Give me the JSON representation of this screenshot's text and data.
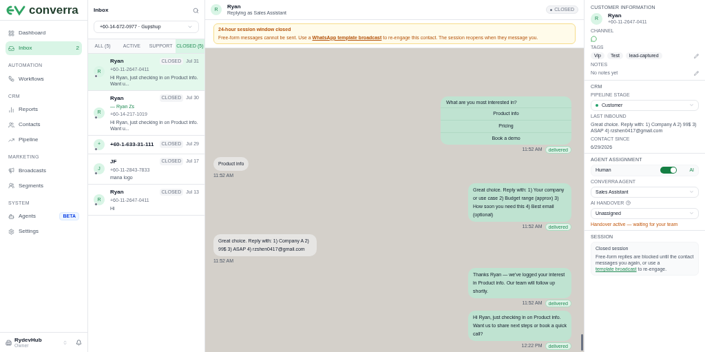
{
  "sidebar": {
    "logo": "converra",
    "sections": [
      {
        "items": [
          {
            "label": "Dashboard",
            "selected": false
          },
          {
            "label": "Inbox",
            "selected": true,
            "count": "2"
          }
        ]
      },
      {
        "heading": "AUTOMATION",
        "items": [
          {
            "label": "Workflows",
            "selected": false
          }
        ]
      },
      {
        "heading": "CRM",
        "items": [
          {
            "label": "Reports",
            "selected": false
          },
          {
            "label": "Contacts",
            "selected": false
          },
          {
            "label": "Pipeline",
            "selected": false
          }
        ]
      },
      {
        "heading": "MARKETING",
        "items": [
          {
            "label": "Broadcasts",
            "selected": false
          },
          {
            "label": "Segments",
            "selected": false
          }
        ]
      },
      {
        "heading": "SYSTEM",
        "items": [
          {
            "label": "Agents",
            "selected": false,
            "badge": "BETA"
          },
          {
            "label": "Settings",
            "selected": false
          }
        ]
      }
    ],
    "account": {
      "name": "RydevHub",
      "role": "Owner"
    }
  },
  "inbox": {
    "title": "Inbox",
    "channel": "+60-14-672-0977 · Gupshup",
    "tabs": [
      {
        "label": "ALL",
        "count": "(5)",
        "selected": false
      },
      {
        "label": "ACTIVE",
        "selected": false
      },
      {
        "label": "SUPPORT",
        "selected": false
      },
      {
        "label": "CLOSED",
        "count": "(5)",
        "selected": true
      }
    ],
    "conversations": [
      {
        "initial": "R",
        "name": "Ryan",
        "phone": "+60-11-2647-0411",
        "preview": "Hi Ryan, just checking in on Product info. Want u...",
        "status": "CLOSED",
        "date": "Jul 31",
        "selected": true
      },
      {
        "initial": "R",
        "name": "Ryan",
        "alias": "— Ryan Zs",
        "phone": "+60-14-217-1019",
        "preview": "Hi Ryan, just checking in on Product info. Want u...",
        "status": "CLOSED",
        "date": "Jul 30",
        "selected": false
      },
      {
        "initial": "+",
        "name": "+60-1-633-31-111",
        "status": "CLOSED",
        "date": "Jul 29",
        "selected": false
      },
      {
        "initial": "J",
        "name": "JF",
        "phone": "+60-11-2843-7833",
        "preview": "mana logo",
        "status": "CLOSED",
        "date": "Jul 17",
        "selected": false
      },
      {
        "initial": "R",
        "name": "Ryan",
        "phone": "+60-11-2647-0411",
        "preview": "Hi",
        "status": "CLOSED",
        "date": "Jul 13",
        "selected": false
      }
    ]
  },
  "chat": {
    "header": {
      "initial": "R",
      "name": "Ryan",
      "subtitle": "Replying as Sales Assistant",
      "status": "CLOSED"
    },
    "banner": {
      "title": "24-hour session window closed",
      "text_before": "Free-form messages cannot be sent. Use a",
      "link": "WhatsApp template broadcast",
      "text_after": "to re-engage this contact. The session reopens when they message you."
    },
    "messages": [
      {
        "kind": "outgoing",
        "text": "What are you most interested in?",
        "options": [
          "Product info",
          "Pricing",
          "Book a demo"
        ],
        "time": "11:52 AM",
        "status": "delivered"
      },
      {
        "kind": "incoming",
        "text": "Product info",
        "time": "11:52 AM"
      },
      {
        "kind": "outgoing",
        "text": "Great choice. Reply with: 1) Your company or use case 2) Budget range (approx) 3) How soon you need this 4) Best email (optional)",
        "time": "11:52 AM",
        "status": "delivered"
      },
      {
        "kind": "incoming",
        "text": "Great choice. Reply with: 1) Company A 2) 99$ 3) ASAP 4) rzshen0417@gmail.com",
        "time": "11:52 AM"
      },
      {
        "kind": "outgoing",
        "text": "Thanks Ryan — we've logged your interest in Product info. Our team will follow up shortly.",
        "time": "11:52 AM",
        "status": "delivered"
      },
      {
        "kind": "outgoing",
        "text": "Hi Ryan, just checking in on Product info. Want us to share next steps or book a quick call?",
        "time": "12:22 PM",
        "status": "delivered"
      }
    ]
  },
  "details": {
    "heading": "CUSTOMER INFORMATION",
    "initial": "R",
    "name": "Ryan",
    "phone": "+60-11-2647-0411",
    "channel_label": "CHANNEL",
    "tags_label": "TAGS",
    "tags": [
      "Vip",
      "Test",
      "lead-captured"
    ],
    "notes_label": "NOTES",
    "notes": "No notes yet",
    "crm_heading": "CRM",
    "pipeline_label": "PIPELINE STAGE",
    "pipeline_stage": "Customer",
    "last_inbound_label": "LAST INBOUND",
    "last_inbound": "Great choice. Reply with: 1) Company A 2) 99$ 3) ASAP 4) rzshen0417@gmail.com",
    "contact_since_label": "CONTACT SINCE",
    "contact_since": "6/29/2026",
    "agent_heading": "AGENT ASSIGNMENT",
    "toggle": {
      "left": "Human",
      "right": "AI",
      "on": true
    },
    "agent_label": "CONVERRA AGENT",
    "agent": "Sales Assistant",
    "handover_label": "AI HANDOVER",
    "handover": "Unassigned",
    "handover_note": "Handover active — waiting for your team",
    "session_heading": "SESSION",
    "session_title": "Closed session",
    "session_before": "Free-form replies are blocked until the contact messages you again, or use a",
    "session_link": "template broadcast",
    "session_after": "to re-engage."
  }
}
